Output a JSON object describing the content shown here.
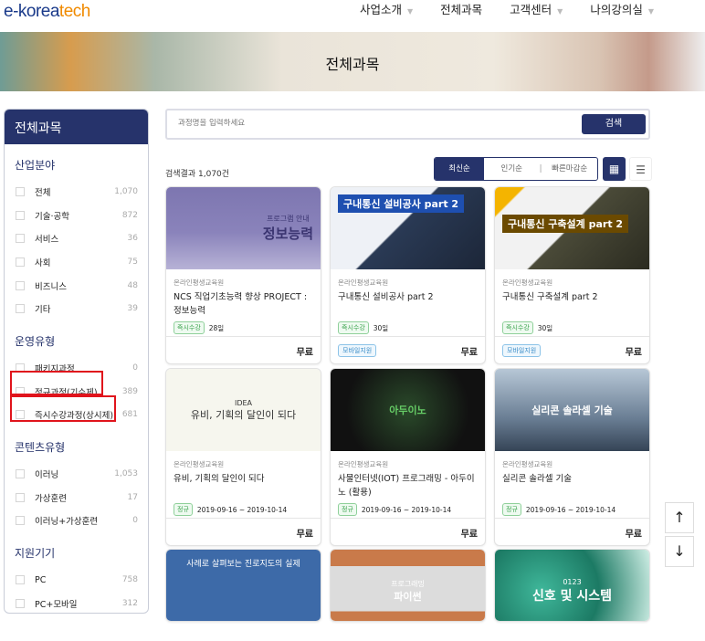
{
  "header": {
    "logo_main": "e-korea",
    "logo_accent": "tech",
    "nav": [
      "사업소개",
      "전체과목",
      "고객센터",
      "나의강의실"
    ]
  },
  "banner": {
    "title": "전체과목"
  },
  "sidebar": {
    "title": "전체과목",
    "groups": [
      {
        "title": "산업분야",
        "items": [
          {
            "label": "전체",
            "count": "1,070"
          },
          {
            "label": "기술·공학",
            "count": "872"
          },
          {
            "label": "서비스",
            "count": "36"
          },
          {
            "label": "사회",
            "count": "75"
          },
          {
            "label": "비즈니스",
            "count": "48"
          },
          {
            "label": "기타",
            "count": "39"
          }
        ]
      },
      {
        "title": "운영유형",
        "items": [
          {
            "label": "패키지과정",
            "count": "0"
          },
          {
            "label": "정규과정(기수제)",
            "count": "389"
          },
          {
            "label": "즉시수강과정(상시제)",
            "count": "681"
          }
        ]
      },
      {
        "title": "콘텐츠유형",
        "items": [
          {
            "label": "이러닝",
            "count": "1,053"
          },
          {
            "label": "가상훈련",
            "count": "17"
          },
          {
            "label": "이러닝+가상훈련",
            "count": "0"
          }
        ]
      },
      {
        "title": "지원기기",
        "items": [
          {
            "label": "PC",
            "count": "758"
          },
          {
            "label": "PC+모바일",
            "count": "312"
          }
        ]
      }
    ]
  },
  "search": {
    "placeholder": "과정명을 입력하세요",
    "button": "검색"
  },
  "results": {
    "label": "검색결과",
    "count": "1,070건"
  },
  "sort": {
    "options": [
      "최신순",
      "인기순",
      "빠른마감순"
    ],
    "active": "최신순"
  },
  "view": {
    "grid_icon": "grid-icon",
    "list_icon": "list-icon"
  },
  "cards": [
    {
      "thumb_text": "정보능력",
      "thumb_sub": "프로그램 안내",
      "org": "온라인평생교육원",
      "title": "NCS 직업기초능력 향상 PROJECT : 정보능력",
      "badge": "즉시수강",
      "duration": "28일",
      "mobile": "",
      "price": "무료"
    },
    {
      "thumb_text": "구내통신 설비공사 part 2",
      "thumb_sub": "",
      "org": "온라인평생교육원",
      "title": "구내통신 설비공사 part 2",
      "badge": "즉시수강",
      "duration": "30일",
      "mobile": "모바일지원",
      "price": "무료"
    },
    {
      "thumb_text": "구내통신 구축설계 part 2",
      "thumb_sub": "",
      "org": "온라인평생교육원",
      "title": "구내통신 구축설계 part 2",
      "badge": "즉시수강",
      "duration": "30일",
      "mobile": "모바일지원",
      "price": "무료"
    },
    {
      "thumb_text": "유비, 기획의 달인이 되다",
      "thumb_sub": "IDEA",
      "org": "온라인평생교육원",
      "title": "유비, 기획의 달인이 되다",
      "badge": "정규",
      "duration": "2019-09-16 ~ 2019-10-14",
      "mobile": "",
      "price": "무료"
    },
    {
      "thumb_text": "아두이노",
      "thumb_sub": "",
      "org": "온라인평생교육원",
      "title": "사물인터넷(IOT) 프로그래밍 - 아두이노 (활용)",
      "badge": "정규",
      "duration": "2019-09-16 ~ 2019-10-14",
      "mobile": "",
      "price": "무료"
    },
    {
      "thumb_text": "실리콘 솔라셀 기술",
      "thumb_sub": "",
      "org": "온라인평생교육원",
      "title": "실리콘 솔라셀 기술",
      "badge": "정규",
      "duration": "2019-09-16 ~ 2019-10-14",
      "mobile": "",
      "price": "무료"
    },
    {
      "thumb_text": "사례로 살펴보는 진로지도의 실제",
      "thumb_sub": ""
    },
    {
      "thumb_text": "파이썬",
      "thumb_sub": "프로그래밍"
    },
    {
      "thumb_text": "신호 및 시스템",
      "thumb_sub": "0123"
    }
  ],
  "floating": {
    "top": "↑",
    "down": "↓"
  }
}
